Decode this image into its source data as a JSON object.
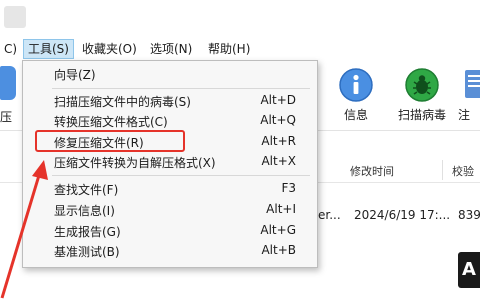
{
  "menubar": {
    "items": [
      {
        "label": "C)"
      },
      {
        "label": "工具(S)"
      },
      {
        "label": "收藏夹(O)"
      },
      {
        "label": "选项(N)"
      },
      {
        "label": "帮助(H)"
      }
    ]
  },
  "toolbar": {
    "left_label": "压",
    "buttons": [
      {
        "label": "信息",
        "icon": "info-icon"
      },
      {
        "label": "扫描病毒",
        "icon": "virus-scan-icon"
      },
      {
        "label": "注",
        "icon": "comment-icon"
      }
    ]
  },
  "list": {
    "columns": [
      "修改时间",
      "校验"
    ],
    "row": {
      "name_fragment": "er...",
      "modified": "2024/6/19 17:...",
      "checksum_fragment": "839"
    }
  },
  "tools_menu": {
    "items": [
      {
        "label": "向导(Z)",
        "shortcut": ""
      },
      {
        "label": "扫描压缩文件中的病毒(S)",
        "shortcut": "Alt+D"
      },
      {
        "label": "转换压缩文件格式(C)",
        "shortcut": "Alt+Q"
      },
      {
        "label": "修复压缩文件(R)",
        "shortcut": "Alt+R"
      },
      {
        "label": "压缩文件转换为自解压格式(X)",
        "shortcut": "Alt+X"
      },
      {
        "label": "查找文件(F)",
        "shortcut": "F3"
      },
      {
        "label": "显示信息(I)",
        "shortcut": "Alt+I"
      },
      {
        "label": "生成报告(G)",
        "shortcut": "Alt+G"
      },
      {
        "label": "基准测试(B)",
        "shortcut": "Alt+B"
      }
    ]
  },
  "colors": {
    "highlight": "#e5332a",
    "arrow": "#e5332a",
    "menu_active": "#cde6f7"
  }
}
